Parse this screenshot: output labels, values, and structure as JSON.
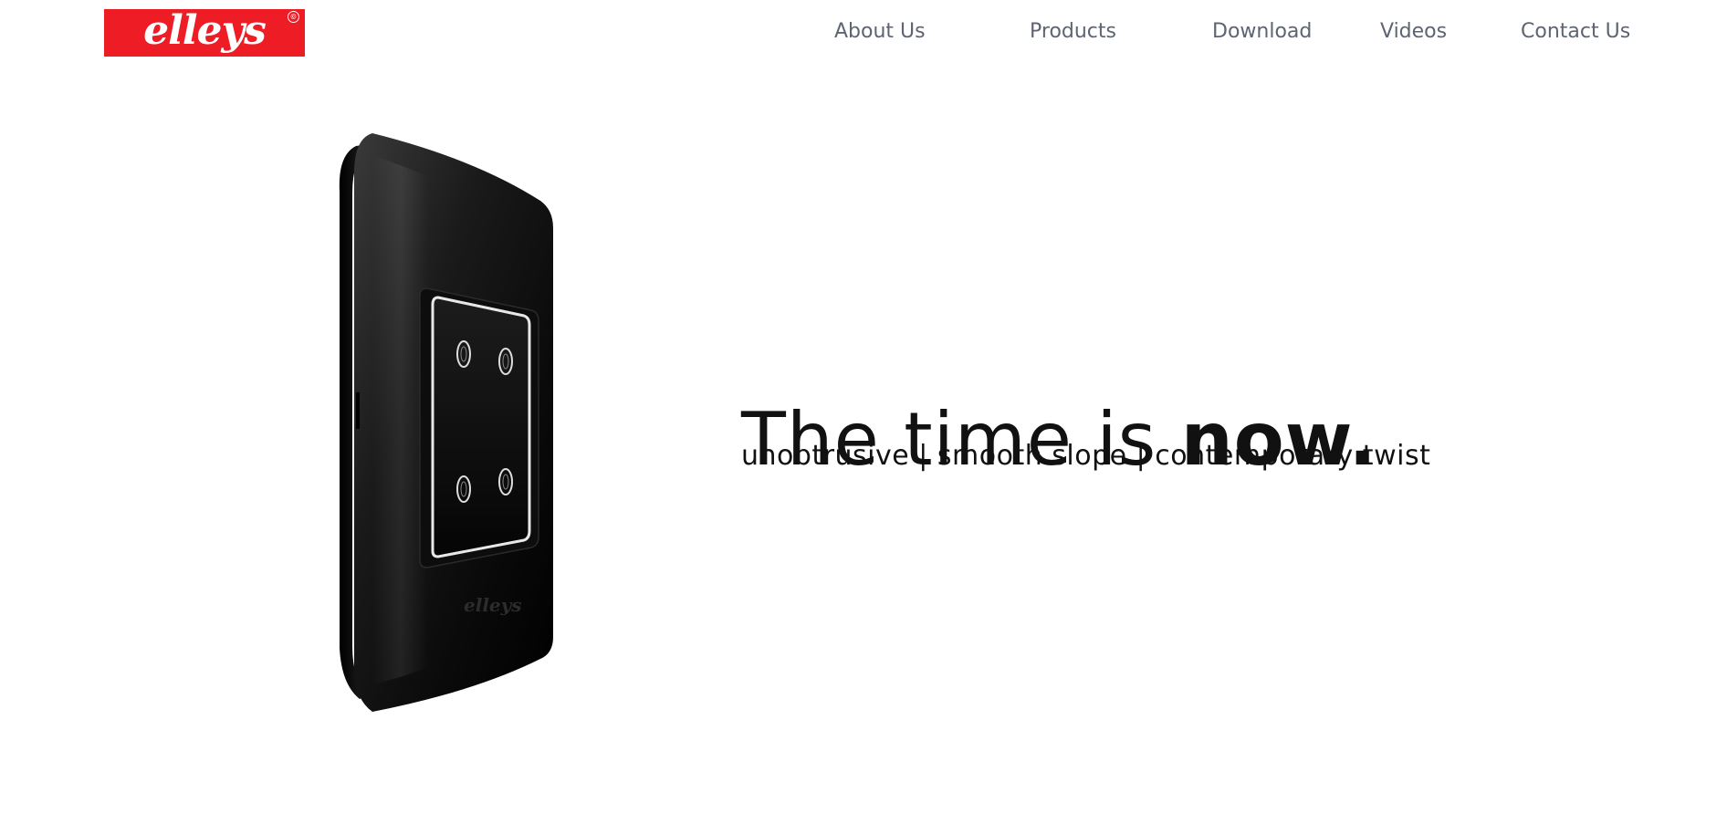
{
  "brand": {
    "logo_text": "elleys",
    "logo_mark": "©",
    "logo_color": "#ee1c25"
  },
  "nav": {
    "items": [
      {
        "label": "About Us"
      },
      {
        "label": "Products"
      },
      {
        "label": "Download"
      },
      {
        "label": "Videos"
      },
      {
        "label": "Contact Us"
      }
    ]
  },
  "hero": {
    "headline_regular": "The time is ",
    "headline_bold": "now.",
    "tagline": "unobtrusive | smooth slope | contemporary twist",
    "product_brand_text": "elleys"
  }
}
